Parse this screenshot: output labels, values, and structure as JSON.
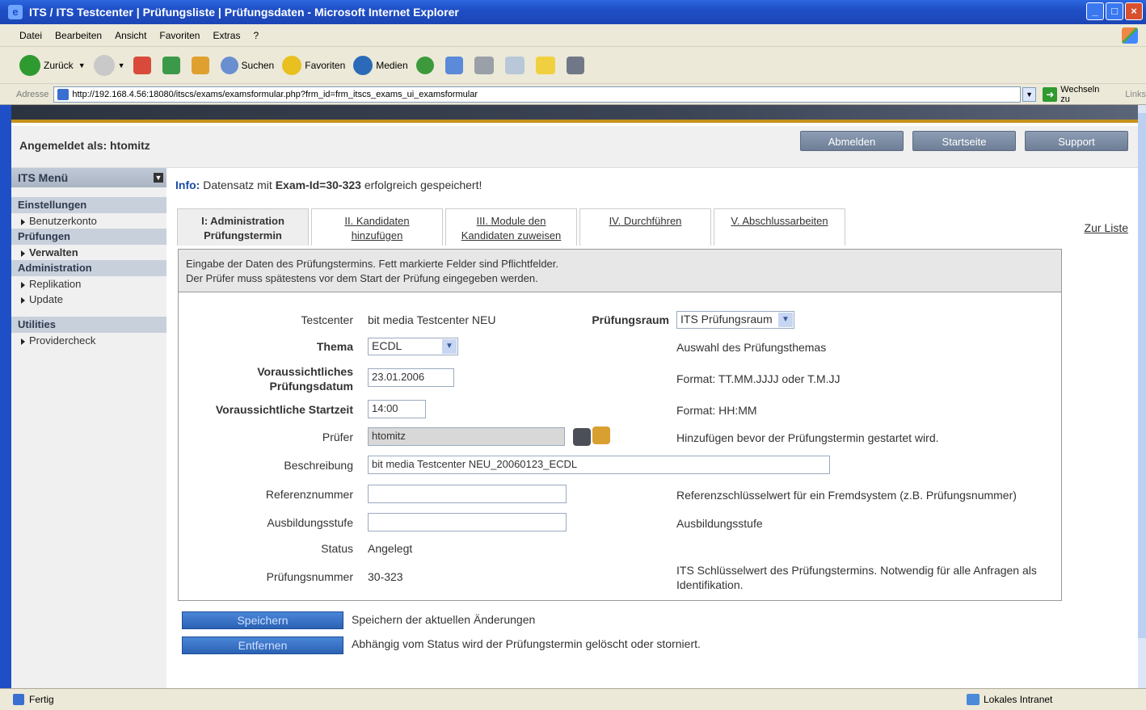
{
  "window": {
    "title": "ITS / ITS Testcenter | Prüfungsliste | Prüfungsdaten - Microsoft Internet Explorer"
  },
  "menu": [
    "Datei",
    "Bearbeiten",
    "Ansicht",
    "Favoriten",
    "Extras",
    "?"
  ],
  "toolbar": {
    "back": "Zurück",
    "search": "Suchen",
    "favorites": "Favoriten",
    "media": "Medien"
  },
  "address": {
    "label": "Adresse",
    "url": "http://192.168.4.56:18080/itscs/exams/examsformular.php?frm_id=frm_itscs_exams_ui_examsformular",
    "go": "Wechseln zu",
    "links": "Links"
  },
  "header": {
    "logged_in": "Angemeldet als: htomitz",
    "buttons": [
      "Abmelden",
      "Startseite",
      "Support"
    ]
  },
  "sidebar": {
    "title": "ITS Menü",
    "sections": [
      {
        "label": "Einstellungen",
        "items": [
          {
            "label": "Benutzerkonto",
            "bold": false
          }
        ]
      },
      {
        "label": "Prüfungen",
        "items": [
          {
            "label": "Verwalten",
            "bold": true
          }
        ]
      },
      {
        "label": "Administration",
        "items": [
          {
            "label": "Replikation",
            "bold": false
          },
          {
            "label": "Update",
            "bold": false
          }
        ]
      },
      {
        "label": "Utilities",
        "items": [
          {
            "label": "Providercheck",
            "bold": false
          }
        ]
      }
    ]
  },
  "info": {
    "label": "Info:",
    "text_before": "Datensatz mit ",
    "bold": "Exam-Id=30-323",
    "text_after": " erfolgreich gespeichert!"
  },
  "tabs": [
    {
      "line1": "I: Administration",
      "line2": "Prüfungstermin",
      "active": true
    },
    {
      "line1": "II. Kandidaten",
      "line2": "hinzufügen",
      "active": false
    },
    {
      "line1": "III. Module den",
      "line2": "Kandidaten zuweisen",
      "active": false
    },
    {
      "line1": "IV. Durchführen",
      "line2": "",
      "active": false
    },
    {
      "line1": "V. Abschlussarbeiten",
      "line2": "",
      "active": false
    }
  ],
  "zur_liste": "Zur Liste",
  "hint": {
    "line1": "Eingabe der Daten des Prüfungstermins. Fett markierte Felder sind Pflichtfelder.",
    "line2": "Der Prüfer muss spätestens vor dem Start der Prüfung eingegeben werden."
  },
  "form": {
    "testcenter_label": "Testcenter",
    "testcenter_value": "bit media Testcenter NEU",
    "raum_label": "Prüfungsraum",
    "raum_value": "ITS Prüfungsraum",
    "thema_label": "Thema",
    "thema_value": "ECDL",
    "thema_help": "Auswahl des Prüfungsthemas",
    "datum_label_1": "Voraussichtliches",
    "datum_label_2": "Prüfungsdatum",
    "datum_value": "23.01.2006",
    "datum_help": "Format: TT.MM.JJJJ oder T.M.JJ",
    "start_label": "Voraussichtliche Startzeit",
    "start_value": "14:00",
    "start_help": "Format: HH:MM",
    "pruefer_label": "Prüfer",
    "pruefer_value": "htomitz",
    "pruefer_help": "Hinzufügen bevor der Prüfungstermin gestartet wird.",
    "beschreibung_label": "Beschreibung",
    "beschreibung_value": "bit media Testcenter NEU_20060123_ECDL",
    "referenz_label": "Referenznummer",
    "referenz_value": "",
    "referenz_help": "Referenzschlüsselwert für ein Fremdsystem (z.B. Prüfungsnummer)",
    "ausbildung_label": "Ausbildungsstufe",
    "ausbildung_value": "",
    "ausbildung_help": "Ausbildungsstufe",
    "status_label": "Status",
    "status_value": "Angelegt",
    "nummer_label": "Prüfungsnummer",
    "nummer_value": "30-323",
    "nummer_help_1": "ITS Schlüsselwert des Prüfungstermins. Notwendig für alle Anfragen als",
    "nummer_help_2": "Identifikation."
  },
  "actions": {
    "save_label": "Speichern",
    "save_desc": "Speichern der aktuellen Änderungen",
    "remove_label": "Entfernen",
    "remove_desc": "Abhängig vom Status wird der Prüfungstermin gelöscht oder storniert."
  },
  "statusbar": {
    "left": "Fertig",
    "zone": "Lokales Intranet"
  }
}
